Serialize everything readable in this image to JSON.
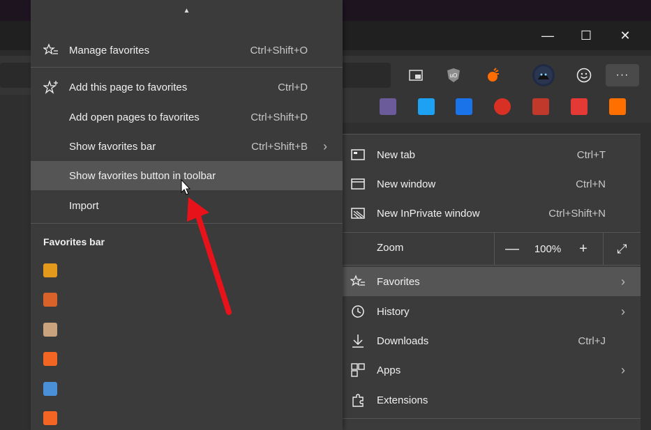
{
  "window_controls": {
    "minimize": "—",
    "maximize": "☐",
    "close": "✕"
  },
  "toolbar": {
    "icons": [
      "reading-view-icon",
      "ublock-icon",
      "extension-icon",
      "profile-avatar",
      "feedback-smiley-icon",
      "more-icon"
    ],
    "more_label": "···"
  },
  "favorites_menu": {
    "scroll_up": "▲",
    "items": [
      {
        "label": "Manage favorites",
        "shortcut": "Ctrl+Shift+O",
        "icon": "star-list-icon"
      },
      {
        "label": "Add this page to favorites",
        "shortcut": "Ctrl+D",
        "icon": "star-add-icon"
      },
      {
        "label": "Add open pages to favorites",
        "shortcut": "Ctrl+Shift+D",
        "icon": ""
      },
      {
        "label": "Show favorites bar",
        "shortcut": "Ctrl+Shift+B",
        "icon": "",
        "submenu": true
      },
      {
        "label": "Show favorites button in toolbar",
        "shortcut": "",
        "icon": "",
        "highlighted": true
      },
      {
        "label": "Import",
        "shortcut": "",
        "icon": ""
      }
    ],
    "section_heading": "Favorites bar",
    "favicon_colors": [
      "#e39a1c",
      "#d9622b",
      "#c9a27e",
      "#f26522",
      "#4a90d9",
      "#f26522"
    ]
  },
  "main_menu": {
    "items": [
      {
        "label": "New tab",
        "shortcut": "Ctrl+T",
        "icon": "new-tab-icon"
      },
      {
        "label": "New window",
        "shortcut": "Ctrl+N",
        "icon": "new-window-icon"
      },
      {
        "label": "New InPrivate window",
        "shortcut": "Ctrl+Shift+N",
        "icon": "inprivate-icon"
      }
    ],
    "zoom": {
      "label": "Zoom",
      "minus": "—",
      "value": "100%",
      "plus": "+",
      "fullscreen": "⤢"
    },
    "items2": [
      {
        "label": "Favorites",
        "icon": "favorites-icon",
        "submenu": true,
        "highlighted": true
      },
      {
        "label": "History",
        "icon": "history-icon",
        "submenu": true
      },
      {
        "label": "Downloads",
        "shortcut": "Ctrl+J",
        "icon": "download-icon"
      },
      {
        "label": "Apps",
        "icon": "apps-icon",
        "submenu": true
      },
      {
        "label": "Extensions",
        "icon": "extensions-icon"
      }
    ]
  },
  "favorites_bar_icons": [
    "#6b5b9a",
    "#1da1f2",
    "#1a73e8",
    "#d93025",
    "#c0392b",
    "#e53935",
    "#ff6f00"
  ],
  "annotation": {
    "arrow_color": "#e8121b"
  }
}
